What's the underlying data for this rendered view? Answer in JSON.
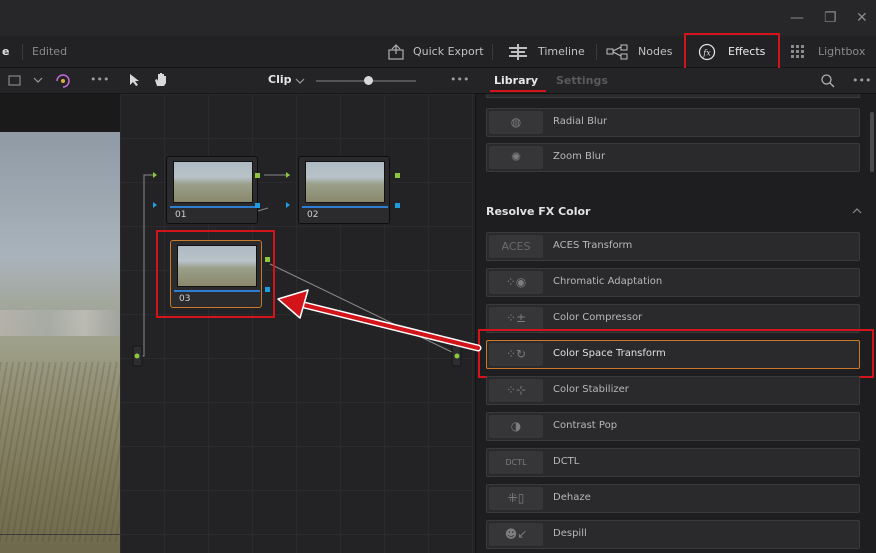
{
  "window": {
    "minimize_icon": "minus",
    "restore_icon": "restore",
    "close_icon": "x"
  },
  "toolbar": {
    "page_name_partial": "e",
    "status": "Edited",
    "quick_export": "Quick Export",
    "timeline": "Timeline",
    "nodes": "Nodes",
    "effects": "Effects",
    "lightbox": "Lightbox"
  },
  "viewer_bar": {
    "clip_label": "Clip",
    "more": "•••"
  },
  "nodes": [
    {
      "label": "01"
    },
    {
      "label": "02"
    },
    {
      "label": "03"
    }
  ],
  "panel": {
    "tabs": {
      "library": "Library",
      "settings": "Settings"
    },
    "blur_items": [
      {
        "label": "Radial Blur",
        "icon": "radial-blur-icon"
      },
      {
        "label": "Zoom Blur",
        "icon": "zoom-blur-icon"
      }
    ],
    "section_title": "Resolve FX Color",
    "color_items": [
      {
        "label": "ACES Transform",
        "thumb": "ACES"
      },
      {
        "label": "Chromatic Adaptation",
        "thumb": ""
      },
      {
        "label": "Color Compressor",
        "thumb": ""
      },
      {
        "label": "Color Space Transform",
        "thumb": ""
      },
      {
        "label": "Color Stabilizer",
        "thumb": ""
      },
      {
        "label": "Contrast Pop",
        "thumb": ""
      },
      {
        "label": "DCTL",
        "thumb": "DCTL"
      },
      {
        "label": "Dehaze",
        "thumb": ""
      },
      {
        "label": "Despill",
        "thumb": ""
      }
    ]
  },
  "colors": {
    "highlight": "#d4141b",
    "accent": "#d4141b"
  }
}
